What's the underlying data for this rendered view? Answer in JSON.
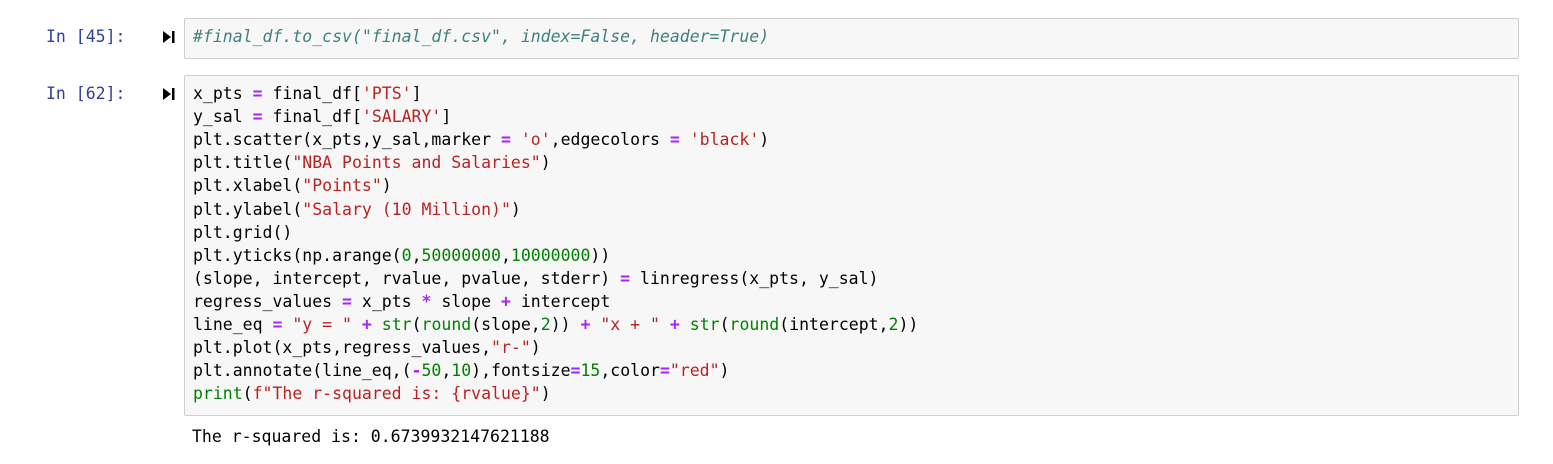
{
  "cells": [
    {
      "prompt": "In [45]:",
      "lines": [
        [
          {
            "t": "#final_df.to_csv(\"final_df.csv\", index=False, header=True)",
            "c": "cm"
          }
        ]
      ]
    },
    {
      "prompt": "In [62]:",
      "lines": [
        [
          {
            "t": "x_pts "
          },
          {
            "t": "=",
            "c": "op"
          },
          {
            "t": " final_df["
          },
          {
            "t": "'PTS'",
            "c": "str"
          },
          {
            "t": "]"
          }
        ],
        [
          {
            "t": "y_sal "
          },
          {
            "t": "=",
            "c": "op"
          },
          {
            "t": " final_df["
          },
          {
            "t": "'SALARY'",
            "c": "str"
          },
          {
            "t": "]"
          }
        ],
        [
          {
            "t": "plt.scatter(x_pts,y_sal,marker "
          },
          {
            "t": "=",
            "c": "op"
          },
          {
            "t": " "
          },
          {
            "t": "'o'",
            "c": "str"
          },
          {
            "t": ",edgecolors "
          },
          {
            "t": "=",
            "c": "op"
          },
          {
            "t": " "
          },
          {
            "t": "'black'",
            "c": "str"
          },
          {
            "t": ")"
          }
        ],
        [
          {
            "t": "plt.title("
          },
          {
            "t": "\"NBA Points and Salaries\"",
            "c": "str"
          },
          {
            "t": ")"
          }
        ],
        [
          {
            "t": "plt.xlabel("
          },
          {
            "t": "\"Points\"",
            "c": "str"
          },
          {
            "t": ")"
          }
        ],
        [
          {
            "t": "plt.ylabel("
          },
          {
            "t": "\"Salary (10 Million)\"",
            "c": "str"
          },
          {
            "t": ")"
          }
        ],
        [
          {
            "t": "plt.grid()"
          }
        ],
        [
          {
            "t": "plt.yticks(np.arange("
          },
          {
            "t": "0",
            "c": "num"
          },
          {
            "t": ","
          },
          {
            "t": "50000000",
            "c": "num"
          },
          {
            "t": ","
          },
          {
            "t": "10000000",
            "c": "num"
          },
          {
            "t": "))"
          }
        ],
        [
          {
            "t": "(slope, intercept, rvalue, pvalue, stderr) "
          },
          {
            "t": "=",
            "c": "op"
          },
          {
            "t": " linregress(x_pts, y_sal)"
          }
        ],
        [
          {
            "t": "regress_values "
          },
          {
            "t": "=",
            "c": "op"
          },
          {
            "t": " x_pts "
          },
          {
            "t": "*",
            "c": "op"
          },
          {
            "t": " slope "
          },
          {
            "t": "+",
            "c": "op"
          },
          {
            "t": " intercept"
          }
        ],
        [
          {
            "t": "line_eq "
          },
          {
            "t": "=",
            "c": "op"
          },
          {
            "t": " "
          },
          {
            "t": "\"y = \"",
            "c": "str"
          },
          {
            "t": " "
          },
          {
            "t": "+",
            "c": "op"
          },
          {
            "t": " "
          },
          {
            "t": "str",
            "c": "kw"
          },
          {
            "t": "("
          },
          {
            "t": "round",
            "c": "kw"
          },
          {
            "t": "(slope,"
          },
          {
            "t": "2",
            "c": "num"
          },
          {
            "t": ")) "
          },
          {
            "t": "+",
            "c": "op"
          },
          {
            "t": " "
          },
          {
            "t": "\"x + \"",
            "c": "str"
          },
          {
            "t": " "
          },
          {
            "t": "+",
            "c": "op"
          },
          {
            "t": " "
          },
          {
            "t": "str",
            "c": "kw"
          },
          {
            "t": "("
          },
          {
            "t": "round",
            "c": "kw"
          },
          {
            "t": "(intercept,"
          },
          {
            "t": "2",
            "c": "num"
          },
          {
            "t": "))"
          }
        ],
        [
          {
            "t": "plt.plot(x_pts,regress_values,"
          },
          {
            "t": "\"r-\"",
            "c": "str"
          },
          {
            "t": ")"
          }
        ],
        [
          {
            "t": "plt.annotate(line_eq,("
          },
          {
            "t": "-",
            "c": "op"
          },
          {
            "t": "50",
            "c": "num"
          },
          {
            "t": ","
          },
          {
            "t": "10",
            "c": "num"
          },
          {
            "t": "),fontsize"
          },
          {
            "t": "=",
            "c": "op"
          },
          {
            "t": "15",
            "c": "num"
          },
          {
            "t": ",color"
          },
          {
            "t": "=",
            "c": "op"
          },
          {
            "t": "\"red\"",
            "c": "str"
          },
          {
            "t": ")"
          }
        ],
        [
          {
            "t": "print",
            "c": "kw"
          },
          {
            "t": "("
          },
          {
            "t": "f\"The r-squared is: {rvalue}\"",
            "c": "str"
          },
          {
            "t": ")"
          }
        ]
      ],
      "output": "The r-squared is: 0.6739932147621188"
    }
  ]
}
